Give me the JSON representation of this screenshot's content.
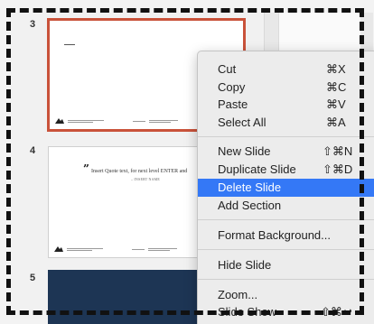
{
  "slides": [
    {
      "number": "3",
      "selected": true
    },
    {
      "number": "4",
      "quote_text": "Insert Quote text, for next level ENTER and",
      "quote_name": "– INSERT NAME"
    },
    {
      "number": "5"
    }
  ],
  "context_menu": {
    "items": [
      {
        "label": "Cut",
        "shortcut": "⌘X"
      },
      {
        "label": "Copy",
        "shortcut": "⌘C"
      },
      {
        "label": "Paste",
        "shortcut": "⌘V"
      },
      {
        "label": "Select All",
        "shortcut": "⌘A"
      },
      {
        "label": "New Slide",
        "shortcut": "⇧⌘N"
      },
      {
        "label": "Duplicate Slide",
        "shortcut": "⇧⌘D"
      },
      {
        "label": "Delete Slide",
        "shortcut": "",
        "highlighted": true
      },
      {
        "label": "Add Section",
        "shortcut": ""
      },
      {
        "label": "Format Background...",
        "shortcut": ""
      },
      {
        "label": "Hide Slide",
        "shortcut": ""
      },
      {
        "label": "Zoom...",
        "shortcut": ""
      },
      {
        "label": "Slide Show",
        "shortcut": "⇧⌘↩"
      }
    ]
  },
  "colors": {
    "selection_border": "#c9523a",
    "menu_highlight": "#3478f6",
    "dark_slide": "#1d3554"
  }
}
